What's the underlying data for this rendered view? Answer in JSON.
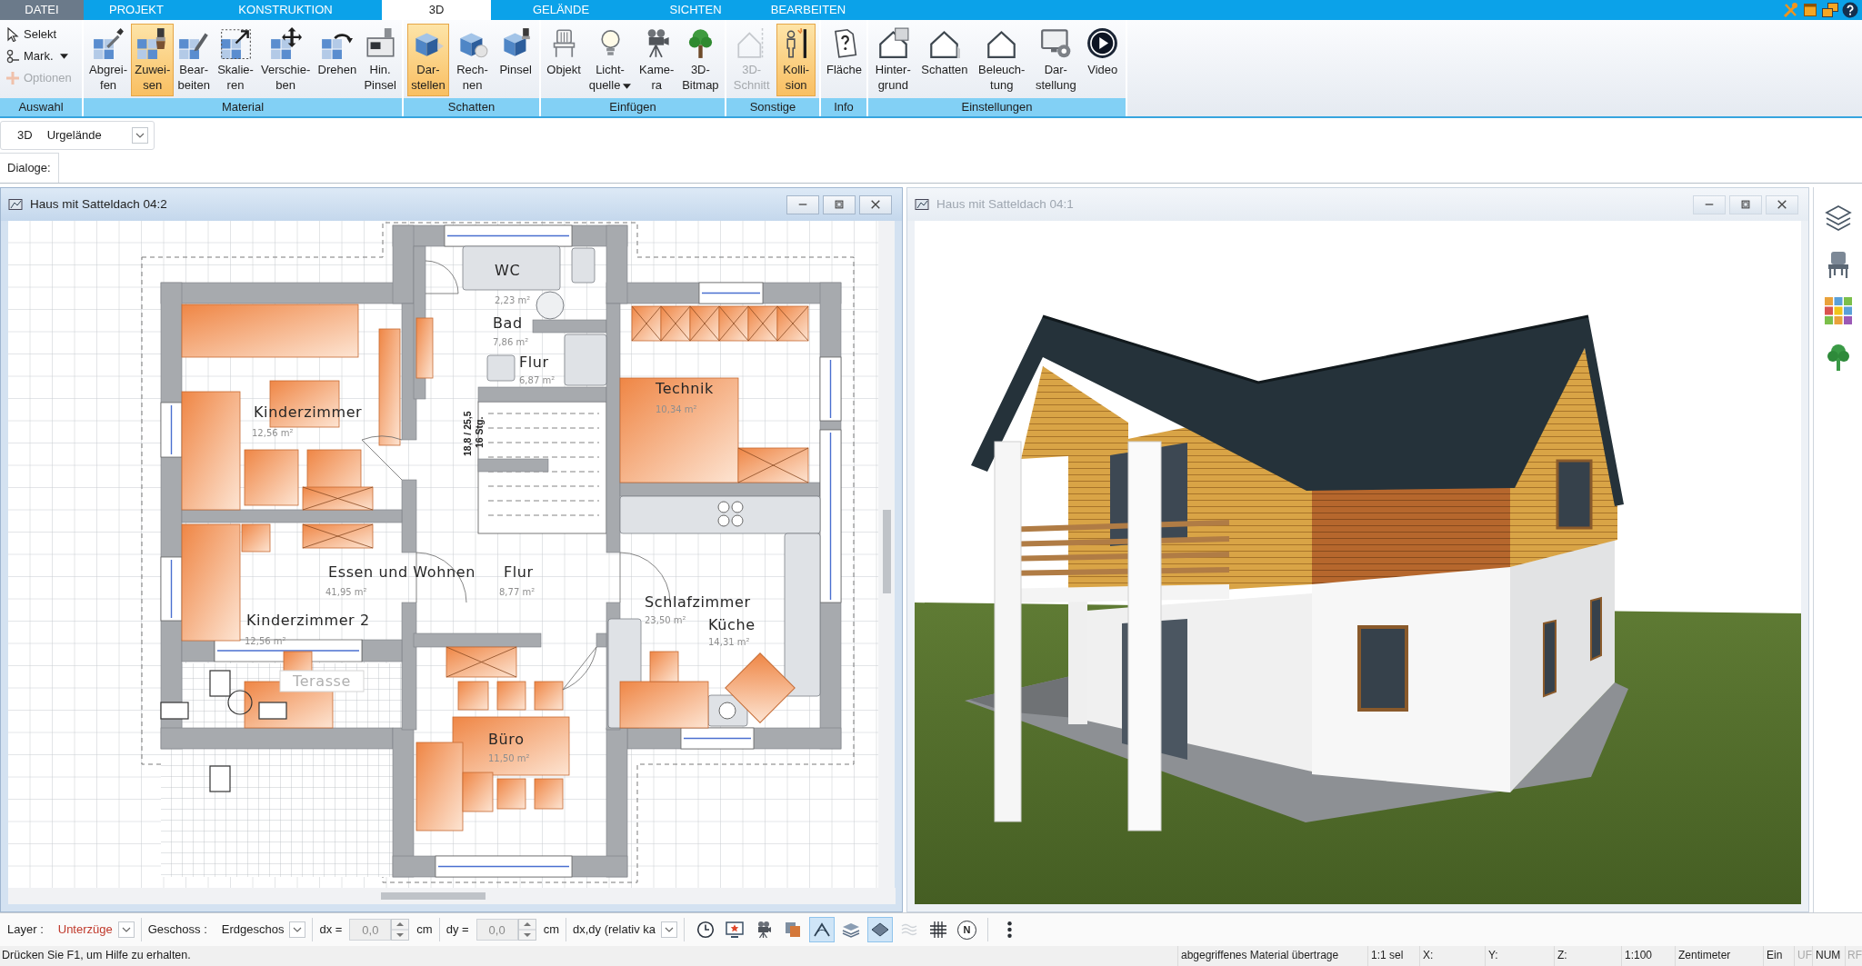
{
  "menu_tabs": [
    {
      "label": "DATEI",
      "kind": "file",
      "selected": false
    },
    {
      "label": "PROJEKT",
      "kind": "tab",
      "selected": false
    },
    {
      "label": "KONSTRUKTION",
      "kind": "tab",
      "selected": false
    },
    {
      "label": "3D",
      "kind": "tab",
      "selected": true
    },
    {
      "label": "GELÄNDE",
      "kind": "tab",
      "selected": false
    },
    {
      "label": "SICHTEN",
      "kind": "tab",
      "selected": false
    },
    {
      "label": "BEARBEITEN",
      "kind": "tab",
      "selected": false
    }
  ],
  "ribbon": [
    {
      "title": "Auswahl",
      "kind": "compact",
      "buttons": [
        {
          "label": "Selekt",
          "selected": false,
          "disabled": false,
          "dropdown": false
        },
        {
          "label": "Mark.",
          "selected": false,
          "disabled": false,
          "dropdown": true
        },
        {
          "label": "Optionen",
          "selected": false,
          "disabled": true,
          "dropdown": false
        }
      ]
    },
    {
      "title": "Material",
      "kind": "large",
      "buttons": [
        {
          "label": "Abgrei-\nfen",
          "selected": false,
          "disabled": false,
          "dropdown": false
        },
        {
          "label": "Zuwei-\nsen",
          "selected": true,
          "disabled": false,
          "dropdown": false
        },
        {
          "label": "Bear-\nbeiten",
          "selected": false,
          "disabled": false,
          "dropdown": false
        },
        {
          "label": "Skalie-\nren",
          "selected": false,
          "disabled": false,
          "dropdown": false
        },
        {
          "label": "Verschie-\nben",
          "selected": false,
          "disabled": false,
          "dropdown": false
        },
        {
          "label": "Drehen",
          "selected": false,
          "disabled": false,
          "dropdown": false
        },
        {
          "label": "Hin.\nPinsel",
          "selected": false,
          "disabled": false,
          "dropdown": false
        }
      ]
    },
    {
      "title": "Schatten",
      "kind": "large",
      "buttons": [
        {
          "label": "Dar-\nstellen",
          "selected": true,
          "disabled": false,
          "dropdown": false
        },
        {
          "label": "Rech-\nnen",
          "selected": false,
          "disabled": false,
          "dropdown": false
        },
        {
          "label": "Pinsel",
          "selected": false,
          "disabled": false,
          "dropdown": false
        }
      ]
    },
    {
      "title": "Einfügen",
      "kind": "large",
      "buttons": [
        {
          "label": "Objekt",
          "selected": false,
          "disabled": false,
          "dropdown": false
        },
        {
          "label": "Licht-\nquelle",
          "selected": false,
          "disabled": false,
          "dropdown": true
        },
        {
          "label": "Kame-\nra",
          "selected": false,
          "disabled": false,
          "dropdown": false
        },
        {
          "label": "3D-\nBitmap",
          "selected": false,
          "disabled": false,
          "dropdown": false
        }
      ]
    },
    {
      "title": "Sonstige",
      "kind": "large",
      "buttons": [
        {
          "label": "3D-\nSchnitt",
          "selected": false,
          "disabled": true,
          "dropdown": false
        },
        {
          "label": "Kolli-\nsion",
          "selected": true,
          "disabled": false,
          "dropdown": false
        }
      ]
    },
    {
      "title": "Info",
      "kind": "large",
      "buttons": [
        {
          "label": "Fläche",
          "selected": false,
          "disabled": false,
          "dropdown": false
        }
      ]
    },
    {
      "title": "Einstellungen",
      "kind": "large",
      "buttons": [
        {
          "label": "Hinter-\ngrund",
          "selected": false,
          "disabled": false,
          "dropdown": false
        },
        {
          "label": "Schatten",
          "selected": false,
          "disabled": false,
          "dropdown": false
        },
        {
          "label": "Beleuch-\ntung",
          "selected": false,
          "disabled": false,
          "dropdown": false
        },
        {
          "label": "Dar-\nstellung",
          "selected": false,
          "disabled": false,
          "dropdown": false
        },
        {
          "label": "Video",
          "selected": false,
          "disabled": false,
          "dropdown": false
        }
      ]
    }
  ],
  "view_bar": {
    "mode": "3D",
    "terrain": "Urgelände"
  },
  "dialogs_label": "Dialoge:",
  "windows": [
    {
      "kind": "plan",
      "title": "Haus mit Satteldach 04:2",
      "active": true,
      "rooms": [
        {
          "kind": "room",
          "name": "WC",
          "area": "2,23 m²"
        },
        {
          "kind": "room",
          "name": "Bad",
          "area": "7,86 m²"
        },
        {
          "kind": "room",
          "name": "Flur",
          "area": "6,87 m²"
        },
        {
          "kind": "room",
          "name": "Kinderzimmer",
          "area": "12,56 m²"
        },
        {
          "kind": "room",
          "name": "Technik",
          "area": "10,34 m²"
        },
        {
          "kind": "room",
          "name": "Essen und Wohnen",
          "area": "41,95 m²"
        },
        {
          "kind": "room",
          "name": "Flur",
          "area": "8,77 m²"
        },
        {
          "kind": "room",
          "name": "Kinderzimmer 2",
          "area": "12,56 m²"
        },
        {
          "kind": "room",
          "name": "Schlafzimmer",
          "area": "23,50 m²"
        },
        {
          "kind": "room",
          "name": "Küche",
          "area": "14,31 m²"
        },
        {
          "kind": "label",
          "name": "Terasse"
        },
        {
          "kind": "room",
          "name": "Büro",
          "area": "11,50 m²"
        }
      ],
      "stair": {
        "measure": "18,8 / 25,5",
        "steps": "16 Stg."
      }
    },
    {
      "kind": "render",
      "title": "Haus mit Satteldach 04:1",
      "active": false
    }
  ],
  "bottom_toolbar": {
    "layer_label": "Layer :",
    "layer": "Unterzüge",
    "floor_label": "Geschoss :",
    "floor": "Erdgeschos",
    "offsets": [
      {
        "label": "dx =",
        "value": "0,0",
        "unit": "cm",
        "disabled": true
      },
      {
        "label": "dy =",
        "value": "0,0",
        "unit": "cm",
        "disabled": true
      }
    ],
    "reference": "dx,dy (relativ ka",
    "tools": [
      {
        "kind": "icon",
        "selected": false,
        "disabled": false
      },
      {
        "kind": "icon",
        "selected": false,
        "disabled": false
      },
      {
        "kind": "icon",
        "selected": false,
        "disabled": false
      },
      {
        "kind": "icon",
        "selected": false,
        "disabled": false
      },
      {
        "kind": "icon",
        "selected": true,
        "disabled": false
      },
      {
        "kind": "icon",
        "selected": false,
        "disabled": false
      },
      {
        "kind": "icon",
        "selected": true,
        "disabled": false
      },
      {
        "kind": "icon",
        "selected": false,
        "disabled": true
      },
      {
        "kind": "icon",
        "selected": false,
        "disabled": false
      },
      {
        "kind": "letter",
        "label": "N",
        "selected": false,
        "disabled": false
      },
      {
        "kind": "icon",
        "selected": false,
        "disabled": false
      }
    ]
  },
  "status_bar": {
    "hint": "Drücken Sie F1, um Hilfe zu erhalten.",
    "panes": [
      {
        "text": "abgegriffenes Material übertrage",
        "disabled": false
      },
      {
        "text": "1:1 sel",
        "disabled": false
      },
      {
        "text": "X:",
        "disabled": false
      },
      {
        "text": "Y:",
        "disabled": false
      },
      {
        "text": "Z:",
        "disabled": false
      },
      {
        "text": "1:100",
        "disabled": false
      },
      {
        "text": "Zentimeter",
        "disabled": false
      },
      {
        "text": "Ein",
        "disabled": false
      },
      {
        "text": "UF",
        "disabled": true
      },
      {
        "text": "NUM",
        "disabled": false
      },
      {
        "text": "RF",
        "disabled": true
      }
    ]
  }
}
